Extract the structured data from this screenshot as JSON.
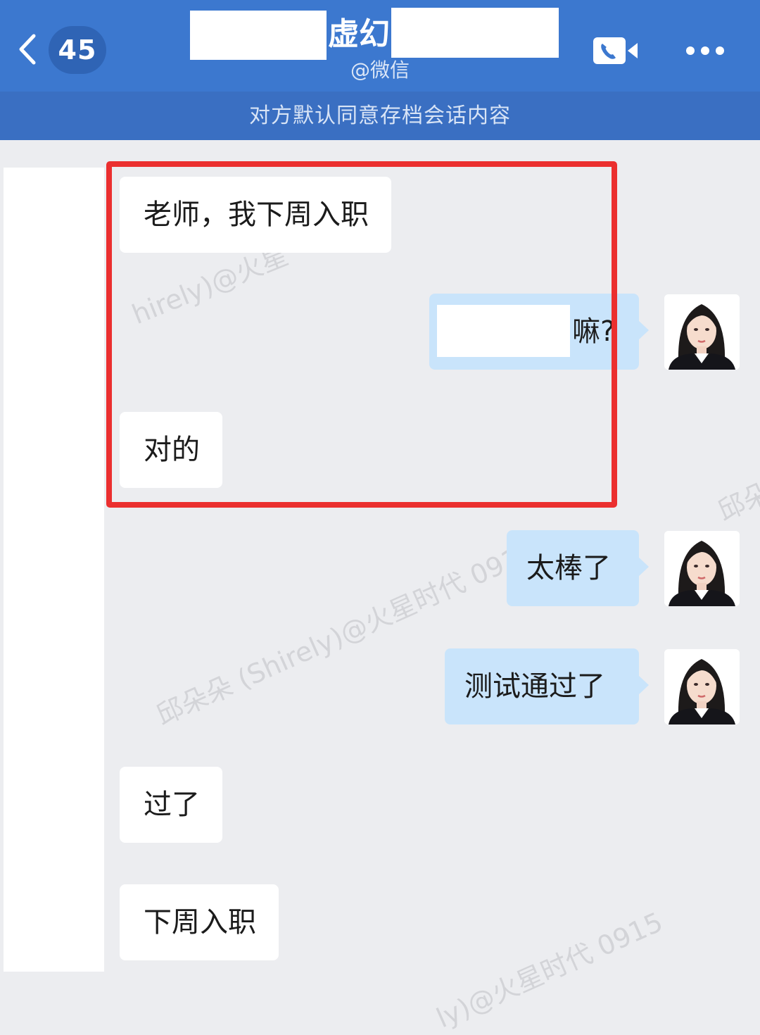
{
  "header": {
    "unread_count": "45",
    "title_visible": "虚幻",
    "subtitle": "@微信",
    "notice": "对方默认同意存档会话内容"
  },
  "messages": [
    {
      "side": "in",
      "text": "老师，我下周入职"
    },
    {
      "side": "out",
      "text": "嘛?"
    },
    {
      "side": "in",
      "text": "对的"
    },
    {
      "side": "out",
      "text": "太棒了"
    },
    {
      "side": "out",
      "text": "测试通过了"
    },
    {
      "side": "in",
      "text": "过了"
    },
    {
      "side": "in",
      "text": "下周入职"
    }
  ],
  "watermark": {
    "main": "邱朵朵 (Shirely)@火星时代 0915",
    "top": "hirely)@火星",
    "right": "邱朵",
    "bottom": "ly)@火星时代 0915"
  },
  "colors": {
    "header_bg": "#3c78cf",
    "notice_bg": "#3a6fc2",
    "chat_bg": "#ecedf0",
    "bubble_out": "#c9e4fb",
    "bubble_in": "#ffffff",
    "highlight": "#eb2f2f"
  },
  "icons": {
    "back": "chevron-left-icon",
    "call": "video-call-icon",
    "more": "more-dots-icon"
  }
}
